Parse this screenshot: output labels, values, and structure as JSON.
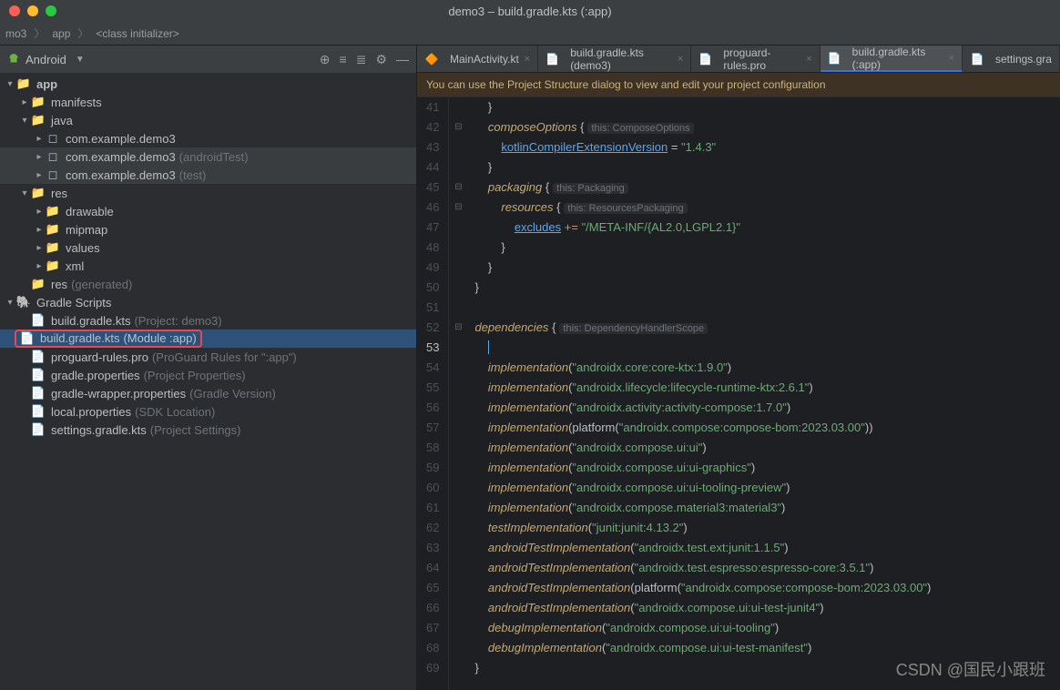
{
  "window": {
    "title": "demo3 – build.gradle.kts (:app)"
  },
  "breadcrumbs": {
    "p0": "mo3",
    "p1": "app",
    "p2": "<class initializer>"
  },
  "projHeader": {
    "label": "Android"
  },
  "tree": {
    "app": "app",
    "manifests": "manifests",
    "java": "java",
    "pkg1": "com.example.demo3",
    "pkg2": "com.example.demo3",
    "pkg2note": "(androidTest)",
    "pkg3": "com.example.demo3",
    "pkg3note": "(test)",
    "res": "res",
    "drawable": "drawable",
    "mipmap": "mipmap",
    "values": "values",
    "xml": "xml",
    "resgen": "res",
    "resgennote": "(generated)",
    "gscripts": "Gradle Scripts",
    "bg1": "build.gradle.kts",
    "bg1note": "(Project: demo3)",
    "bg2": "build.gradle.kts",
    "bg2note": "(Module :app)",
    "proguard": "proguard-rules.pro",
    "proguardnote": "(ProGuard Rules for \":app\")",
    "gprop": "gradle.properties",
    "gpropnote": "(Project Properties)",
    "gwrap": "gradle-wrapper.properties",
    "gwrapnote": "(Gradle Version)",
    "local": "local.properties",
    "localnote": "(SDK Location)",
    "settings": "settings.gradle.kts",
    "settingsnote": "(Project Settings)"
  },
  "tabs": {
    "t0": "MainActivity.kt",
    "t1": "build.gradle.kts (demo3)",
    "t2": "proguard-rules.pro",
    "t3": "build.gradle.kts (:app)",
    "t4": "settings.gra"
  },
  "banner": "You can use the Project Structure dialog to view and edit your project configuration",
  "lines": {
    "start": 42,
    "end": 69
  },
  "code": {
    "composeOptions": "composeOptions",
    "thisCompose": "this: ComposeOptions",
    "kcev": "kotlinCompilerExtensionVersion",
    "kcevVal": "\"1.4.3\"",
    "packaging": "packaging",
    "thisPack": "this: Packaging",
    "resources": "resources",
    "thisRes": "this: ResourcesPackaging",
    "excludes": "excludes",
    "plusEq": "+=",
    "excludesVal": "\"/META-INF/{AL2.0,LGPL2.1}\"",
    "dependencies": "dependencies",
    "thisDep": "this: DependencyHandlerScope",
    "impl": "implementation",
    "testImpl": "testImplementation",
    "andTestImpl": "androidTestImplementation",
    "debugImpl": "debugImplementation",
    "platform": "platform",
    "dep54": "\"androidx.core:core-ktx:1.9.0\"",
    "dep55": "\"androidx.lifecycle:lifecycle-runtime-ktx:2.6.1\"",
    "dep56": "\"androidx.activity:activity-compose:1.7.0\"",
    "dep57": "\"androidx.compose:compose-bom:2023.03.00\"",
    "dep58": "\"androidx.compose.ui:ui\"",
    "dep59": "\"androidx.compose.ui:ui-graphics\"",
    "dep60": "\"androidx.compose.ui:ui-tooling-preview\"",
    "dep61": "\"androidx.compose.material3:material3\"",
    "dep62": "\"junit:junit:4.13.2\"",
    "dep63": "\"androidx.test.ext:junit:1.1.5\"",
    "dep64": "\"androidx.test.espresso:espresso-core:3.5.1\"",
    "dep65": "\"androidx.compose:compose-bom:2023.03.00\"",
    "dep66": "\"androidx.compose.ui:ui-test-junit4\"",
    "dep67": "\"androidx.compose.ui:ui-tooling\"",
    "dep68": "\"androidx.compose.ui:ui-test-manifest\""
  },
  "watermark": "CSDN @国民小跟班"
}
